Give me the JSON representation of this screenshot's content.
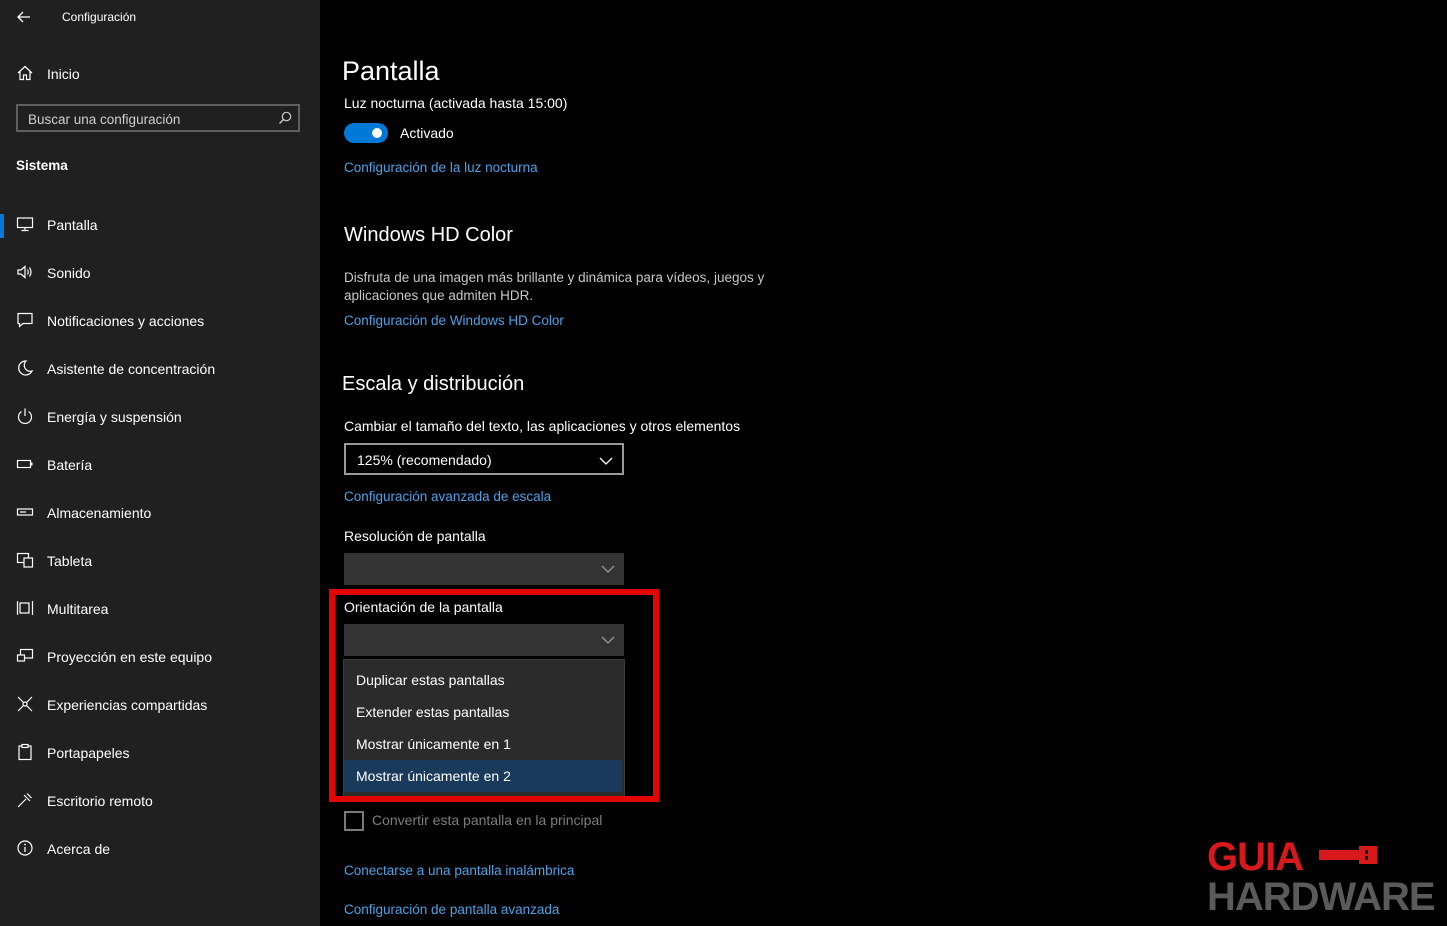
{
  "window": {
    "title": "Configuración"
  },
  "sidebar": {
    "home_label": "Inicio",
    "search_placeholder": "Buscar una configuración",
    "section": "Sistema",
    "items": [
      {
        "label": "Pantalla",
        "icon": "monitor-icon",
        "active": true
      },
      {
        "label": "Sonido",
        "icon": "speaker-icon"
      },
      {
        "label": "Notificaciones y acciones",
        "icon": "notification-icon"
      },
      {
        "label": "Asistente de concentración",
        "icon": "moon-icon"
      },
      {
        "label": "Energía y suspensión",
        "icon": "power-icon"
      },
      {
        "label": "Batería",
        "icon": "battery-icon"
      },
      {
        "label": "Almacenamiento",
        "icon": "storage-icon"
      },
      {
        "label": "Tableta",
        "icon": "tablet-icon"
      },
      {
        "label": "Multitarea",
        "icon": "multitask-icon"
      },
      {
        "label": "Proyección en este equipo",
        "icon": "projection-icon"
      },
      {
        "label": "Experiencias compartidas",
        "icon": "share-icon"
      },
      {
        "label": "Portapapeles",
        "icon": "clipboard-icon"
      },
      {
        "label": "Escritorio remoto",
        "icon": "remote-desktop-icon"
      },
      {
        "label": "Acerca de",
        "icon": "info-icon"
      }
    ]
  },
  "main": {
    "title": "Pantalla",
    "night_light": {
      "label": "Luz nocturna (activada hasta 15:00)",
      "toggle_state": "Activado",
      "link": "Configuración de la luz nocturna"
    },
    "hdr": {
      "heading": "Windows HD Color",
      "description": "Disfruta de una imagen más brillante y dinámica para vídeos, juegos y aplicaciones que admiten HDR.",
      "link": "Configuración de Windows HD Color"
    },
    "scale": {
      "heading": "Escala y distribución",
      "size_label": "Cambiar el tamaño del texto, las aplicaciones y otros elementos",
      "size_value": "125% (recomendado)",
      "advanced_link": "Configuración avanzada de escala",
      "resolution_label": "Resolución de pantalla",
      "orientation_label": "Orientación de la pantalla"
    },
    "multi_display": {
      "options": [
        "Duplicar estas pantallas",
        "Extender estas pantallas",
        "Mostrar únicamente en 1",
        "Mostrar únicamente en 2"
      ],
      "selected_index": 3,
      "main_display_checkbox": "Convertir esta pantalla en la principal",
      "wireless_link": "Conectarse a una pantalla inalámbrica",
      "advanced_link": "Configuración de pantalla avanzada"
    }
  },
  "watermark": {
    "line1": "GUIA",
    "line2": "HARDWARE"
  },
  "colors": {
    "accent": "#0078d7",
    "link": "#4ea1e6",
    "highlight": "#e10600",
    "sidebar_bg": "#202020"
  }
}
